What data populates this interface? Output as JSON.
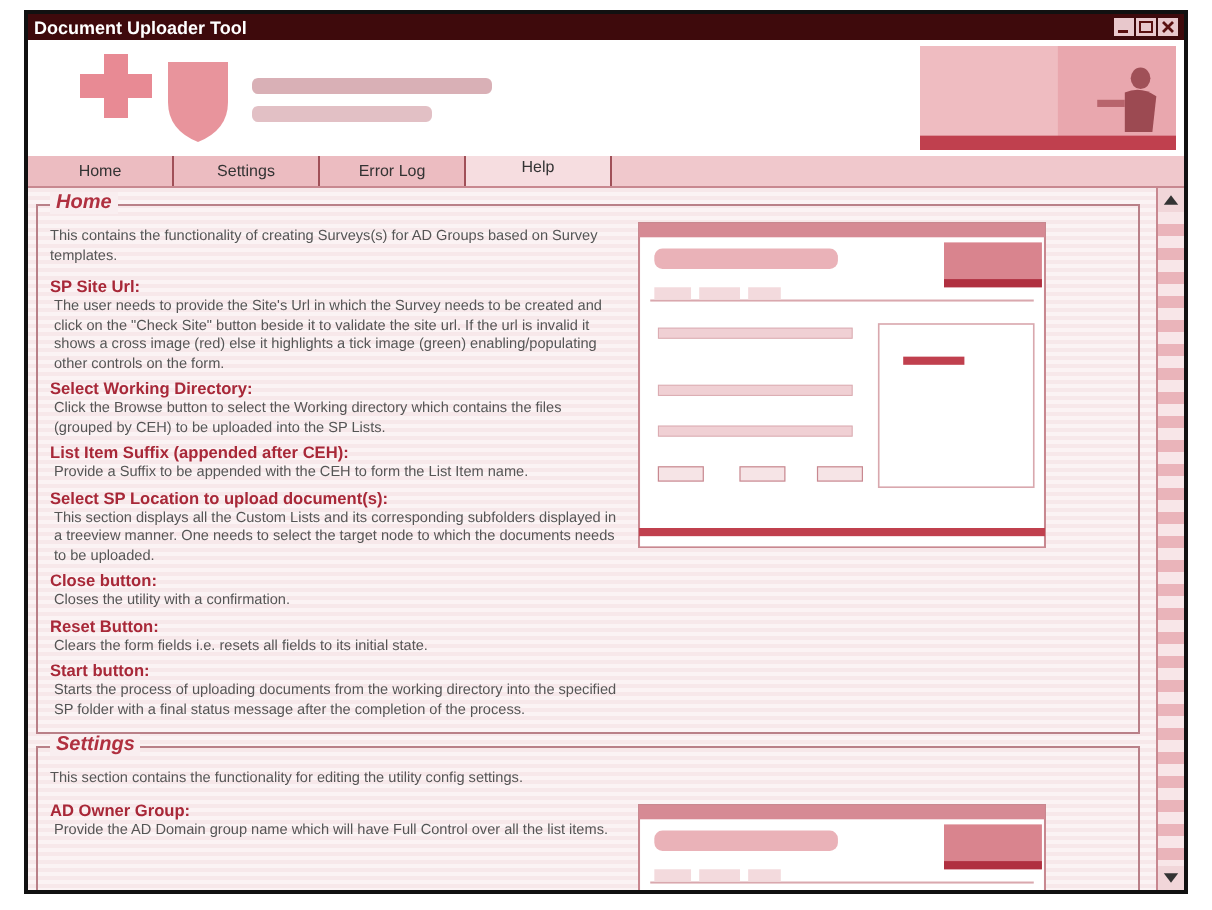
{
  "window": {
    "title": "Document Uploader Tool"
  },
  "tabs": [
    {
      "label": "Home",
      "selected": false
    },
    {
      "label": "Settings",
      "selected": false
    },
    {
      "label": "Error Log",
      "selected": false
    },
    {
      "label": "Help",
      "selected": true
    }
  ],
  "sections": [
    {
      "title": "Home",
      "intro": "This contains the functionality of creating Surveys(s) for AD Groups based on Survey templates.",
      "items": [
        {
          "heading": "SP Site Url:",
          "text": "The user needs to provide the Site's Url in which the Survey needs to be created and click on the \"Check Site\" button beside it to validate the site url. If the url is invalid it shows a cross image (red) else it highlights a tick image (green) enabling/populating other controls on the form."
        },
        {
          "heading": "Select Working Directory:",
          "text": "Click the Browse button to select the Working directory which contains the files (grouped by CEH) to be uploaded into the SP Lists."
        },
        {
          "heading": "List Item Suffix (appended after CEH):",
          "text": "Provide a Suffix to be appended with the CEH to form the List Item name."
        },
        {
          "heading": "Select SP Location to upload document(s):",
          "text": "This section displays all the Custom Lists and its corresponding subfolders displayed in a treeview manner. One needs to select the target node to which the documents needs to be uploaded."
        },
        {
          "heading": "Close button:",
          "text": "Closes the utility with a confirmation."
        },
        {
          "heading": "Reset Button:",
          "text": "Clears the form fields i.e. resets all fields to its initial state."
        },
        {
          "heading": "Start button:",
          "text": "Starts the process of uploading documents from the working directory into the specified SP folder with a final status message after the completion of the process."
        }
      ]
    },
    {
      "title": "Settings",
      "intro": "This section contains the functionality for editing the utility config settings.",
      "items": [
        {
          "heading": "AD Owner Group:",
          "text": "Provide the AD Domain group name which will have Full Control over all the list items."
        }
      ]
    }
  ]
}
